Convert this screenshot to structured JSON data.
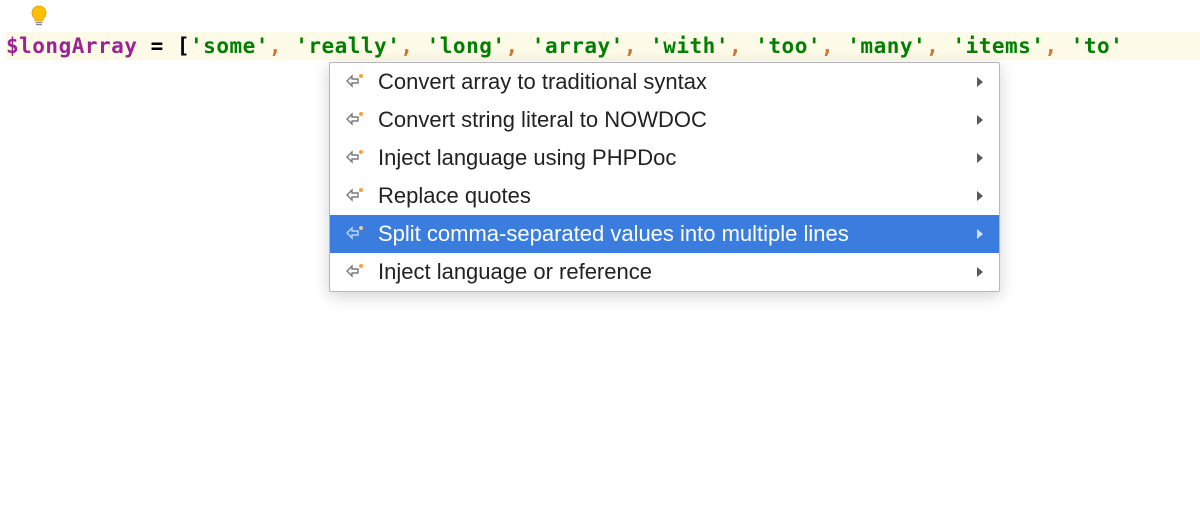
{
  "code": {
    "variable": "$longArray",
    "equals": " = ",
    "open_bracket": "[",
    "items": [
      "'some'",
      "'really'",
      "'long'",
      "'array'",
      "'with'",
      "'too'",
      "'many'",
      "'items'",
      "'to'"
    ]
  },
  "menu": {
    "items": [
      {
        "label": "Convert array to traditional syntax",
        "has_submenu": true,
        "selected": false
      },
      {
        "label": "Convert string literal to NOWDOC",
        "has_submenu": true,
        "selected": false
      },
      {
        "label": "Inject language using PHPDoc",
        "has_submenu": true,
        "selected": false
      },
      {
        "label": "Replace quotes",
        "has_submenu": true,
        "selected": false
      },
      {
        "label": "Split comma-separated values into multiple lines",
        "has_submenu": true,
        "selected": true
      },
      {
        "label": "Inject language or reference",
        "has_submenu": true,
        "selected": false
      }
    ]
  },
  "colors": {
    "highlight_bg": "#fefae8",
    "selected_bg": "#3b7dde",
    "string_color": "#008000",
    "variable_color": "#9b2393"
  }
}
